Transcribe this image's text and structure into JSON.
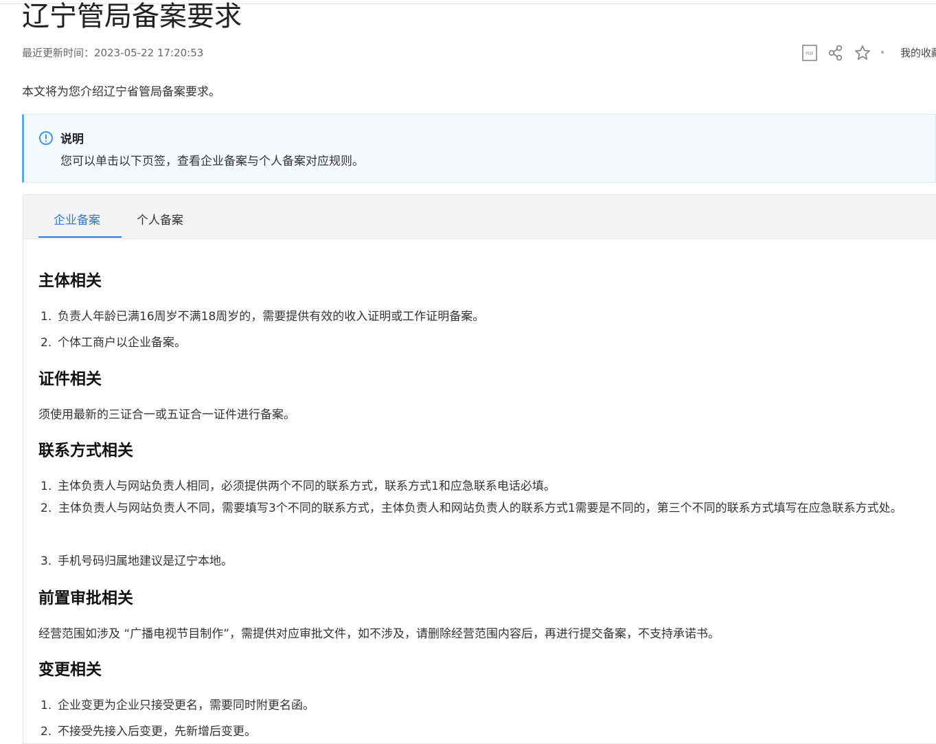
{
  "header": {
    "title": "辽宁管局备案要求",
    "updated": "最近更新时间：2023-05-22 17:20:53",
    "pdf_label": "PDF",
    "favorites": "我的收藏"
  },
  "intro": "本文将为您介绍辽宁省管局备案要求。",
  "note": {
    "title": "说明",
    "body": "您可以单击以下页签，查看企业备案与个人备案对应规则。"
  },
  "tabs": [
    {
      "label": "企业备案",
      "active": true
    },
    {
      "label": "个人备案",
      "active": false
    }
  ],
  "sections": {
    "subject": {
      "title": "主体相关",
      "items": [
        "负责人年龄已满16周岁不满18周岁的，需要提供有效的收入证明或工作证明备案。",
        "个体工商户以企业备案。"
      ]
    },
    "certificate": {
      "title": "证件相关",
      "text": "须使用最新的三证合一或五证合一证件进行备案。"
    },
    "contact": {
      "title": "联系方式相关",
      "items": [
        "主体负责人与网站负责人相同，必须提供两个不同的联系方式，联系方式1和应急联系电话必填。",
        "主体负责人与网站负责人不同，需要填写3个不同的联系方式，主体负责人和网站负责人的联系方式1需要是不同的，第三个不同的联系方式填写在应急联系方式处。",
        "手机号码归属地建议是辽宁本地。"
      ]
    },
    "approval": {
      "title": "前置审批相关",
      "text": "经营范围如涉及 “广播电视节目制作”，需提供对应审批文件，如不涉及，请删除经营范围内容后，再进行提交备案，不支持承诺书。"
    },
    "change": {
      "title": "变更相关",
      "items": [
        "企业变更为企业只接受更名，需要同时附更名函。",
        "不接受先接入后变更，先新增后变更。"
      ]
    }
  },
  "numbers": [
    "1.",
    "2.",
    "3."
  ],
  "colors": {
    "accent": "#2f79d4",
    "note_border": "#58a8ed",
    "note_bg": "#f5fafe",
    "tab_bar_bg": "#f3f4f5"
  }
}
